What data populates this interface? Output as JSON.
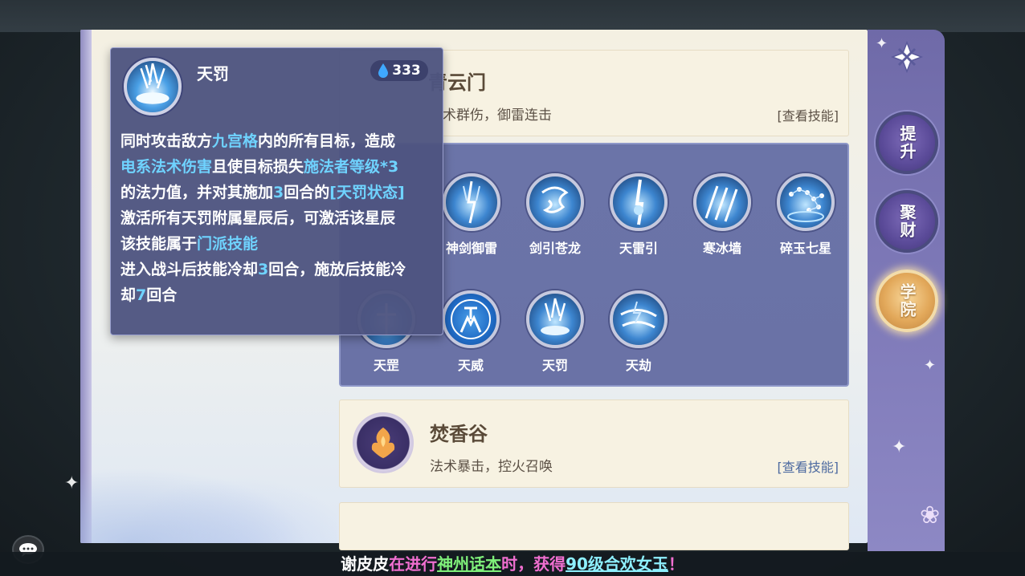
{
  "tooltip": {
    "title": "天罚",
    "cost": "333",
    "lines": [
      [
        {
          "t": "同时攻击敌方"
        },
        {
          "t": "九宫格",
          "c": "hl"
        },
        {
          "t": "内的所有目标，造成"
        }
      ],
      [
        {
          "t": "电系法术伤害",
          "c": "hl"
        },
        {
          "t": "且使目标损失"
        },
        {
          "t": "施法者等级*3",
          "c": "hl"
        }
      ],
      [
        {
          "t": "的法力值，并对其施加"
        },
        {
          "t": "3",
          "c": "hl"
        },
        {
          "t": "回合的"
        },
        {
          "t": "[天罚状态]",
          "c": "hl"
        }
      ],
      [
        {
          "t": "激活所有天罚附属星辰后，可激活该星辰"
        }
      ],
      [
        {
          "t": "该技能属于"
        },
        {
          "t": "门派技能",
          "c": "hl"
        }
      ],
      [
        {
          "t": "进入战斗后技能冷却"
        },
        {
          "t": "3",
          "c": "hl"
        },
        {
          "t": "回合，施放后技能冷"
        }
      ],
      [
        {
          "t": "却"
        },
        {
          "t": "7",
          "c": "hl"
        },
        {
          "t": "回合"
        }
      ]
    ]
  },
  "sects": {
    "qingyun": {
      "title": "青云门",
      "desc": "术群伤，御雷连击",
      "link": "[查看技能]"
    },
    "fenxiang": {
      "title": "焚香谷",
      "desc": "法术暴击，控火召唤",
      "link": "[查看技能]"
    }
  },
  "skills": [
    {
      "name": "神剑御雷",
      "icon": "lightning-sword-icon"
    },
    {
      "name": "剑引苍龙",
      "icon": "dragon-icon"
    },
    {
      "name": "天雷引",
      "icon": "thunder-bolt-icon"
    },
    {
      "name": "寒冰墙",
      "icon": "ice-wall-icon"
    },
    {
      "name": "碎玉七星",
      "icon": "seven-stars-icon"
    },
    {
      "name": "天罡",
      "icon": "heaven-icon"
    },
    {
      "name": "天威",
      "icon": "heaven-might-icon"
    },
    {
      "name": "天罚",
      "icon": "heaven-punish-icon"
    },
    {
      "name": "天劫",
      "icon": "heaven-tribulation-icon"
    }
  ],
  "side_buttons": {
    "upgrade": "提升",
    "gather": "聚财",
    "academy": "学院"
  },
  "ticker": {
    "name": "谢皮皮",
    "p1": "在进行",
    "activity": "神州话本",
    "p2": "时，获得",
    "item": "90级合欢女玉",
    "end": "！"
  },
  "colors": {
    "highlight": "#6fd3ff",
    "panel_purple": "#6b74a8",
    "link_blue": "#4d6aa0"
  }
}
